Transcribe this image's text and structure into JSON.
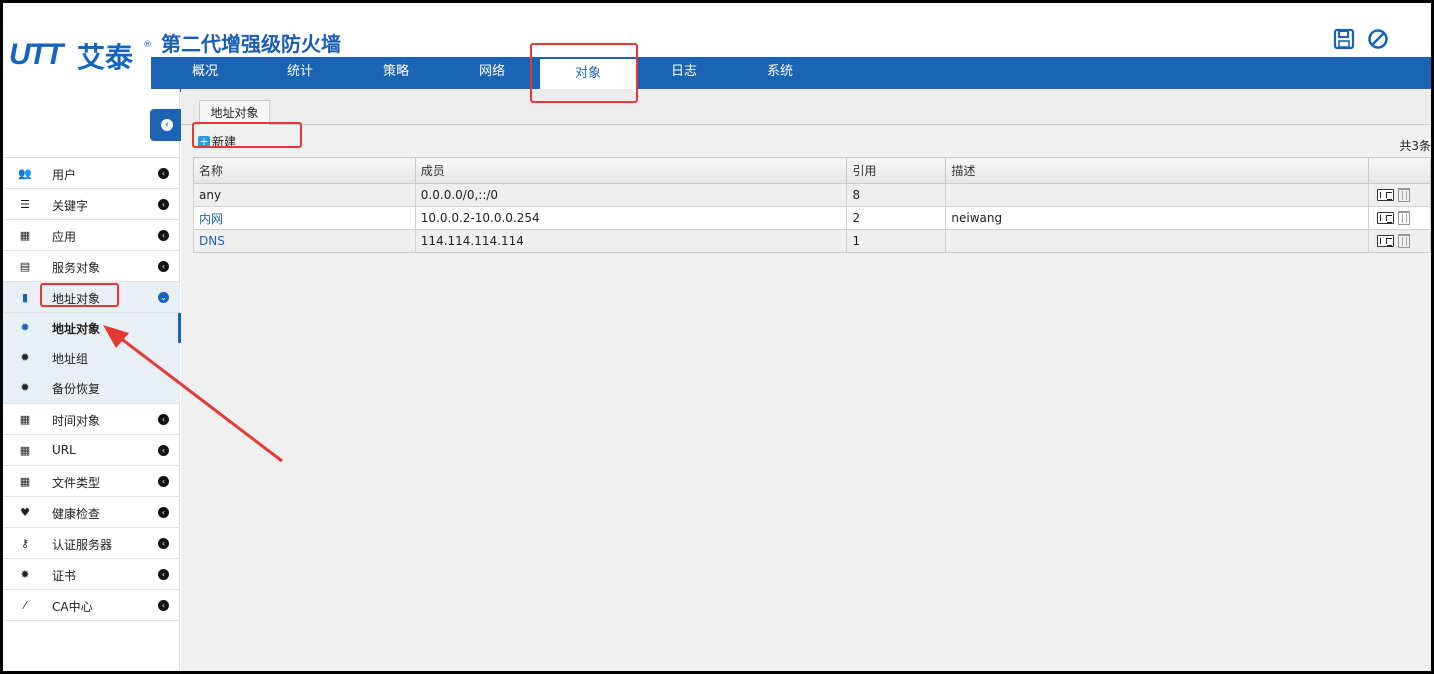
{
  "header": {
    "logo_mark": "UTT",
    "logo_text": "艾泰",
    "logo_reg": "®",
    "app_title": "第二代增强级防火墙"
  },
  "nav": {
    "items": [
      {
        "label": "概况"
      },
      {
        "label": "统计"
      },
      {
        "label": "策略"
      },
      {
        "label": "网络"
      },
      {
        "label": "对象",
        "active": true
      },
      {
        "label": "日志"
      },
      {
        "label": "系统"
      }
    ]
  },
  "sidebar": {
    "items": [
      {
        "label": "用户",
        "icon": "users-icon"
      },
      {
        "label": "关键字",
        "icon": "list-icon"
      },
      {
        "label": "应用",
        "icon": "grid-icon"
      },
      {
        "label": "服务对象",
        "icon": "server-icon"
      },
      {
        "label": "地址对象",
        "icon": "tablet-icon",
        "expanded": true
      },
      {
        "label": "时间对象",
        "icon": "calendar-icon"
      },
      {
        "label": "URL",
        "icon": "calendar-icon"
      },
      {
        "label": "文件类型",
        "icon": "calendar-icon"
      },
      {
        "label": "健康检查",
        "icon": "heartbeat-icon"
      },
      {
        "label": "认证服务器",
        "icon": "key-icon"
      },
      {
        "label": "证书",
        "icon": "certificate-icon"
      },
      {
        "label": "CA中心",
        "icon": "wand-icon"
      }
    ],
    "sub_items": [
      {
        "label": "地址对象",
        "icon": "gear-icon",
        "active": true
      },
      {
        "label": "地址组",
        "icon": "gear-icon"
      },
      {
        "label": "备份恢复",
        "icon": "gear-icon"
      }
    ]
  },
  "main": {
    "tab_label": "地址对象",
    "new_button_label": "新建",
    "count_text": "共3条",
    "columns": [
      "名称",
      "成员",
      "引用",
      "描述",
      ""
    ],
    "rows": [
      {
        "name": "any",
        "members": "0.0.0.0/0,::/0",
        "refs": "8",
        "desc": "",
        "link": false
      },
      {
        "name": "内网",
        "members": "10.0.0.2-10.0.0.254",
        "refs": "2",
        "desc": "neiwang",
        "link": true
      },
      {
        "name": "DNS",
        "members": "114.114.114.114",
        "refs": "1",
        "desc": "",
        "link": true
      }
    ]
  },
  "colors": {
    "brand_blue": "#1b64b4",
    "active_underline": "#f5b400",
    "annotation_red": "#e53935"
  }
}
